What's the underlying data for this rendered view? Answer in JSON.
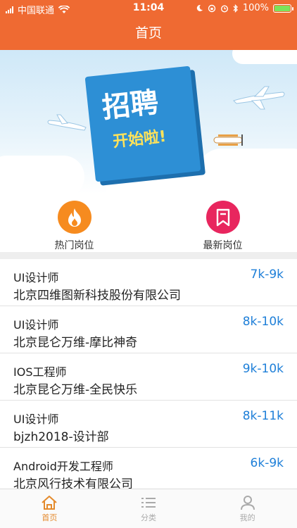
{
  "status_bar": {
    "carrier": "中国联通",
    "time": "11:04",
    "battery": "100%"
  },
  "header": {
    "title": "首页"
  },
  "banner": {
    "headline": "招聘",
    "subline": "开始啦!"
  },
  "categories": [
    {
      "label": "热门岗位",
      "icon": "flame-icon",
      "color": "#f68b1f"
    },
    {
      "label": "最新岗位",
      "icon": "bookmark-icon",
      "color": "#e8265e"
    }
  ],
  "jobs": [
    {
      "title": "UI设计师",
      "company": "北京四维图新科技股份有限公司",
      "salary": "7k-9k"
    },
    {
      "title": "UI设计师",
      "company": "北京昆仑万维-摩比神奇",
      "salary": "8k-10k"
    },
    {
      "title": "IOS工程师",
      "company": "北京昆仑万维-全民快乐",
      "salary": "9k-10k"
    },
    {
      "title": "UI设计师",
      "company": "bjzh2018-设计部",
      "salary": "8k-11k"
    },
    {
      "title": "Android开发工程师",
      "company": "北京风行技术有限公司",
      "salary": "6k-9k"
    }
  ],
  "tabbar": {
    "home": {
      "label": "首页",
      "icon": "home-icon",
      "active": true
    },
    "category": {
      "label": "分类",
      "icon": "list-icon",
      "active": false
    },
    "mine": {
      "label": "我的",
      "icon": "person-icon",
      "active": false
    }
  },
  "colors": {
    "brand": "#ef6a32",
    "salary": "#1e7fd8",
    "active_tab": "#e48a2c",
    "inactive_tab": "#aaaaaa"
  }
}
